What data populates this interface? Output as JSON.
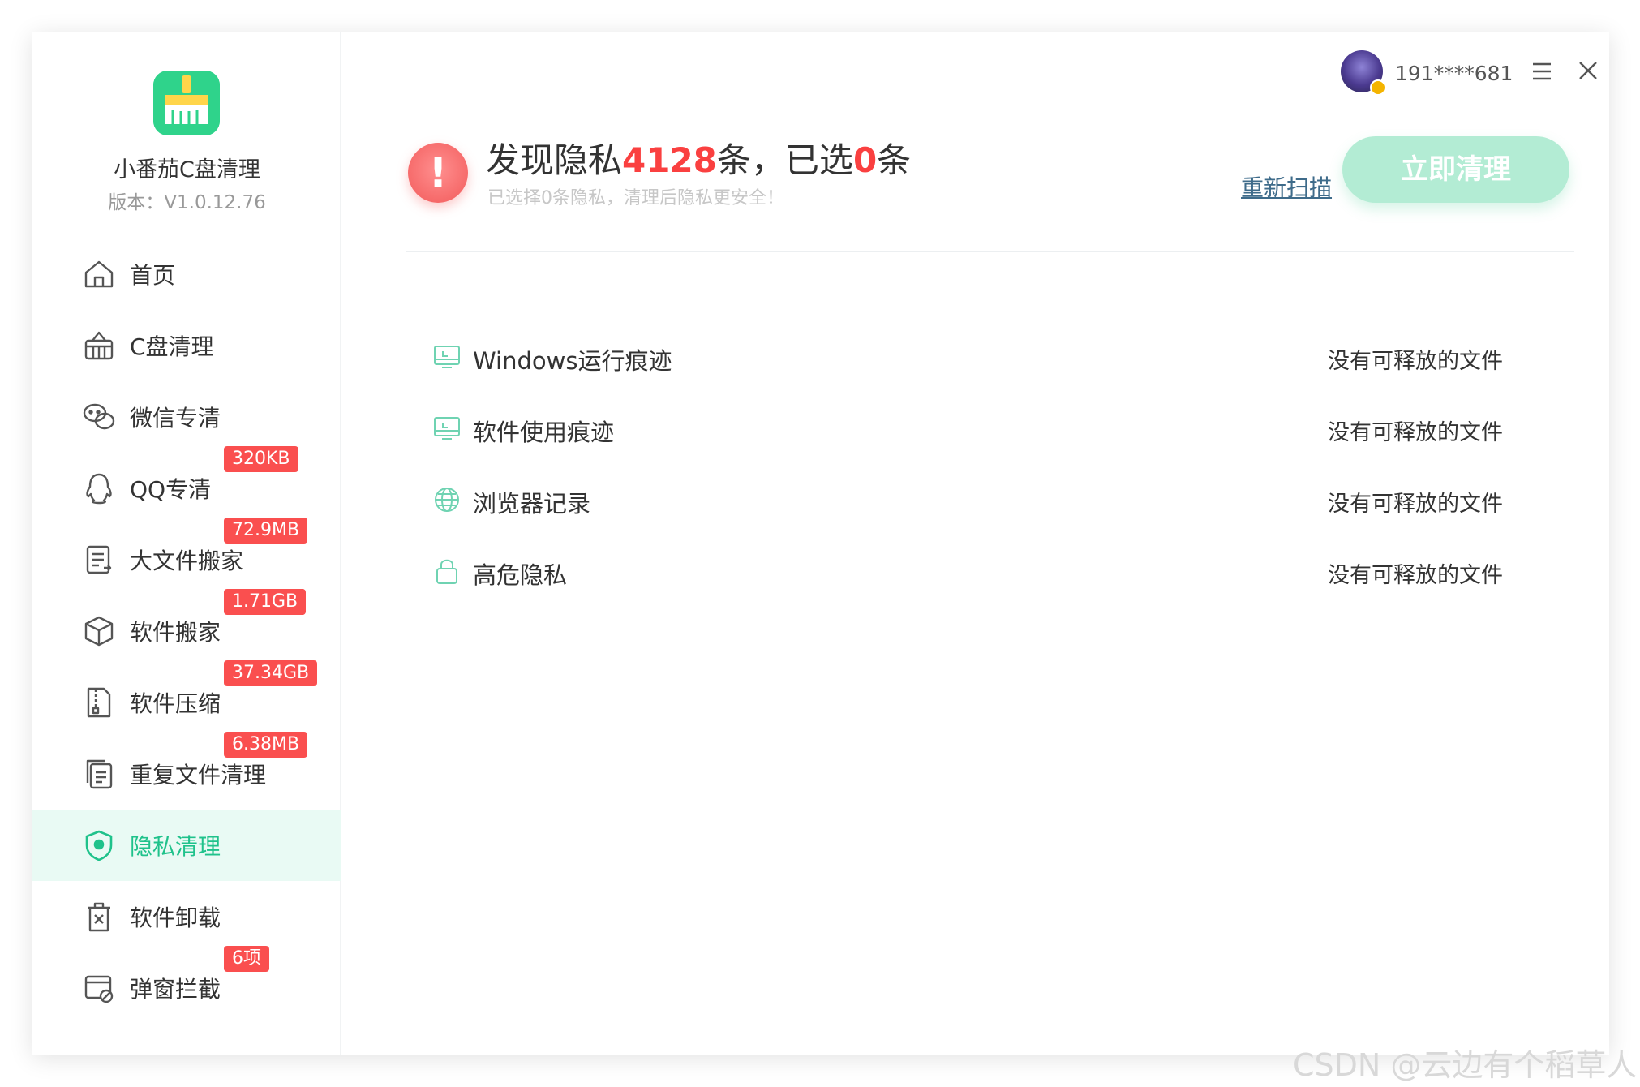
{
  "app": {
    "name": "小番茄C盘清理",
    "version": "版本：V1.0.12.76",
    "logo_icon": "broom-icon"
  },
  "sidebar": {
    "items": [
      {
        "label": "首页",
        "icon": "home-icon",
        "badge": ""
      },
      {
        "label": "C盘清理",
        "icon": "basket-icon",
        "badge": ""
      },
      {
        "label": "微信专清",
        "icon": "wechat-icon",
        "badge": ""
      },
      {
        "label": "QQ专清",
        "icon": "qq-icon",
        "badge": "320KB"
      },
      {
        "label": "大文件搬家",
        "icon": "document-icon",
        "badge": "72.9MB"
      },
      {
        "label": "软件搬家",
        "icon": "box-icon",
        "badge": "1.71GB"
      },
      {
        "label": "软件压缩",
        "icon": "zip-icon",
        "badge": "37.34GB"
      },
      {
        "label": "重复文件清理",
        "icon": "copy-icon",
        "badge": "6.38MB"
      },
      {
        "label": "隐私清理",
        "icon": "shield-icon",
        "badge": "",
        "active": true
      },
      {
        "label": "软件卸载",
        "icon": "trash-icon",
        "badge": ""
      },
      {
        "label": "弹窗拦截",
        "icon": "popup-block-icon",
        "badge": "6项"
      }
    ]
  },
  "header": {
    "username": "191****681",
    "menu_icon": "hamburger-icon",
    "close_icon": "close-icon"
  },
  "summary": {
    "prefix": "发现隐私",
    "found_count": "4128",
    "mid": "条，已选",
    "selected_count": "0",
    "suffix": "条",
    "subtitle": "已选择0条隐私，清理后隐私更安全！",
    "rescan_label": "重新扫描",
    "clean_label": "立即清理"
  },
  "privacy_list": [
    {
      "label": "Windows运行痕迹",
      "status": "没有可释放的文件",
      "icon": "monitor-icon"
    },
    {
      "label": "软件使用痕迹",
      "status": "没有可释放的文件",
      "icon": "monitor-icon"
    },
    {
      "label": "浏览器记录",
      "status": "没有可释放的文件",
      "icon": "globe-icon"
    },
    {
      "label": "高危隐私",
      "status": "没有可释放的文件",
      "icon": "lock-icon"
    }
  ],
  "watermark": "CSDN @云边有个稻草人",
  "colors": {
    "accent": "#1fc28b",
    "badge": "#fa4f4f",
    "alert": "#f66a6a",
    "button_disabled": "#b3ecd4"
  }
}
